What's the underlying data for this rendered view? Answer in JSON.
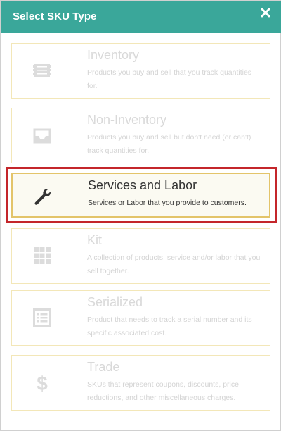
{
  "dialog": {
    "title": "Select SKU Type",
    "close_icon": "close-icon"
  },
  "sku_types": [
    {
      "title": "Inventory",
      "description": "Products you buy and sell that you track quantities for.",
      "icon": "barcode-icon",
      "state": "disabled"
    },
    {
      "title": "Non-Inventory",
      "description": "Products you buy and sell but don't need (or can't) track quantities for.",
      "icon": "tray-icon",
      "state": "disabled"
    },
    {
      "title": "Services and Labor",
      "description": "Services or Labor that you provide to customers.",
      "icon": "wrench-icon",
      "state": "highlighted"
    },
    {
      "title": "Kit",
      "description": "A collection of products, service and/or labor that you sell together.",
      "icon": "grid-icon",
      "state": "disabled"
    },
    {
      "title": "Serialized",
      "description": "Product that needs to track a serial number and its specific associated cost.",
      "icon": "list-icon",
      "state": "disabled"
    },
    {
      "title": "Trade",
      "description": "SKUs that represent coupons, discounts, price reductions, and other miscellaneous charges.",
      "icon": "dollar-icon",
      "state": "disabled"
    }
  ],
  "colors": {
    "header": "#3aa79a",
    "card_border": "#f3e7b8",
    "selected_border": "#e3c46a",
    "highlight_frame": "#c4262b",
    "disabled_text": "#d9d9d9",
    "active_text": "#333333"
  }
}
